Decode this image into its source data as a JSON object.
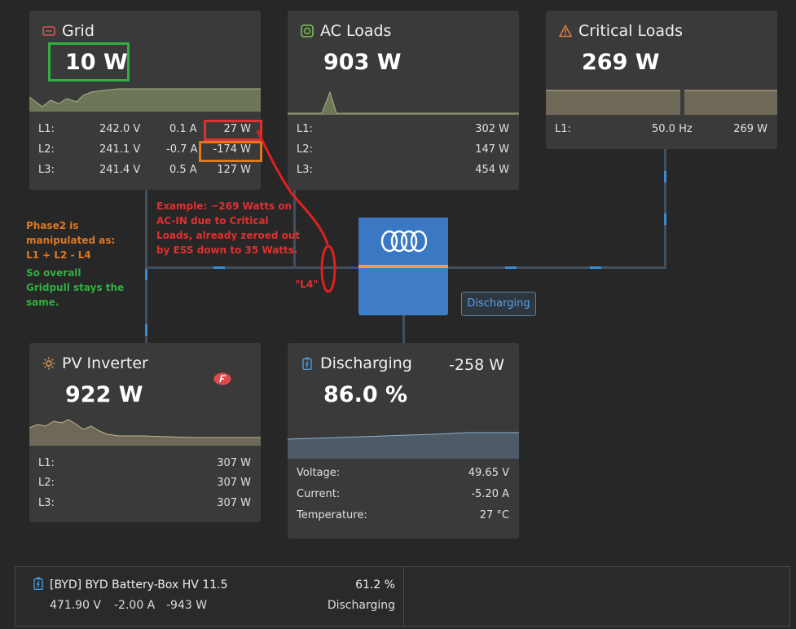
{
  "grid": {
    "title": "Grid",
    "value": "10 W",
    "rows": [
      {
        "label": "L1:",
        "voltage": "242.0 V",
        "current": "0.1 A",
        "power": "27 W"
      },
      {
        "label": "L2:",
        "voltage": "241.1 V",
        "current": "-0.7 A",
        "power": "-174 W"
      },
      {
        "label": "L3:",
        "voltage": "241.4 V",
        "current": "0.5 A",
        "power": "127 W"
      }
    ]
  },
  "ac_loads": {
    "title": "AC Loads",
    "value": "903 W",
    "rows": [
      {
        "label": "L1:",
        "power": "302 W"
      },
      {
        "label": "L2:",
        "power": "147 W"
      },
      {
        "label": "L3:",
        "power": "454 W"
      }
    ]
  },
  "critical_loads": {
    "title": "Critical Loads",
    "value": "269 W",
    "rows": [
      {
        "label": "L1:",
        "frequency": "50.0 Hz",
        "power": "269 W"
      }
    ]
  },
  "pv_inverter": {
    "title": "PV Inverter",
    "value": "922 W",
    "rows": [
      {
        "label": "L1:",
        "power": "307 W"
      },
      {
        "label": "L2:",
        "power": "307 W"
      },
      {
        "label": "L3:",
        "power": "307 W"
      }
    ]
  },
  "battery": {
    "title": "Discharging",
    "power": "-258 W",
    "soc": "86.0 %",
    "rows": [
      {
        "label": "Voltage:",
        "value": "49.65 V"
      },
      {
        "label": "Current:",
        "value": "-5.20 A"
      },
      {
        "label": "Temperature:",
        "value": "27 °C"
      }
    ]
  },
  "inverter": {
    "status": "Discharging"
  },
  "annotations": {
    "example": [
      "Example: ~269 Watts on",
      "AC-IN due to Critical",
      "Loads, already zeroed out",
      "by ESS down to 35 Watts."
    ],
    "phase2": [
      "Phase2 is",
      "manipulated as:",
      "L1 + L2 - L4"
    ],
    "gridpull": [
      "So overall",
      "Gridpull stays the",
      "same."
    ],
    "l4": "\"L4\""
  },
  "bottom_battery": {
    "name": "[BYD] BYD Battery-Box HV 11.5",
    "voltage": "471.90 V",
    "current": "-2.00 A",
    "power": "-943 W",
    "soc": "61.2 %",
    "state": "Discharging"
  },
  "colors": {
    "grid_icon": "#e05050",
    "ac_icon": "#7cc050",
    "critical_icon": "#e08040",
    "pv_icon": "#e0a050",
    "battery_icon": "#4a9ae0",
    "annot_red": "#e03030",
    "annot_orange": "#e07820",
    "annot_green": "#30b040"
  }
}
